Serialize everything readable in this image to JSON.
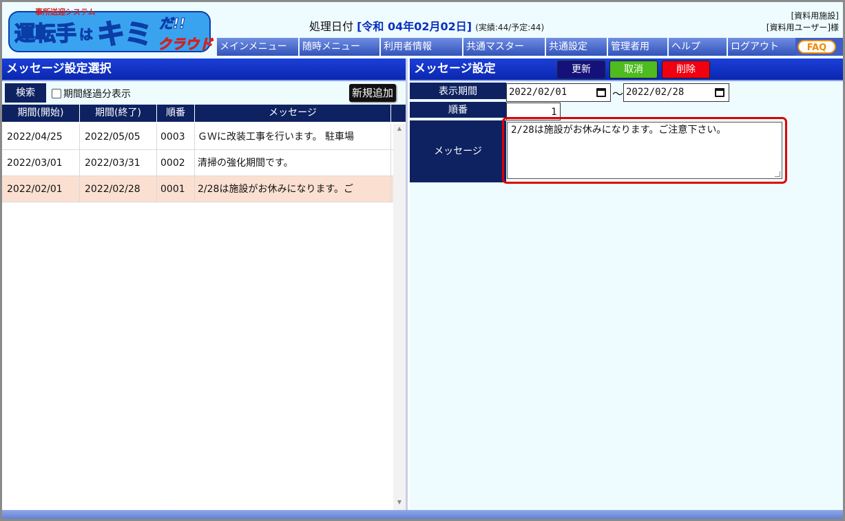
{
  "app": {
    "logo": {
      "tagline": "事所送迎システム",
      "name_a": "運転手",
      "name_b": "は",
      "name_c": "キミ",
      "name_d": "だ!!",
      "name_e": "クラウド"
    }
  },
  "header": {
    "proc_date_label": "処理日付",
    "proc_date_value": "[令和 04年02月02日]",
    "counts": "(実績:44/予定:44)",
    "facility": "[資料用施設]",
    "user": "[資料用ユーザー]様"
  },
  "menu": {
    "items": [
      {
        "label": "メインメニュー"
      },
      {
        "label": "随時メニュー"
      },
      {
        "label": "利用者情報"
      },
      {
        "label": "共通マスター"
      },
      {
        "label": "共通設定"
      },
      {
        "label": "管理者用"
      },
      {
        "label": "ヘルプ"
      },
      {
        "label": "ログアウト"
      }
    ],
    "faq": "FAQ"
  },
  "left_panel": {
    "title": "メッセージ設定選択",
    "search_label": "検索",
    "elapsed_checkbox_label": "期間経過分表示",
    "elapsed_checked": false,
    "add_button": "新規追加",
    "columns": [
      "期間(開始)",
      "期間(終了)",
      "順番",
      "メッセージ"
    ],
    "rows": [
      {
        "start": "2022/04/25",
        "end": "2022/05/05",
        "order": "0003",
        "message": "ＧＷに改装工事を行います。 駐車場",
        "selected": false
      },
      {
        "start": "2022/03/01",
        "end": "2022/03/31",
        "order": "0002",
        "message": "清掃の強化期間です。",
        "selected": false
      },
      {
        "start": "2022/02/01",
        "end": "2022/02/28",
        "order": "0001",
        "message": "2/28は施設がお休みになります。ご",
        "selected": true
      }
    ]
  },
  "right_panel": {
    "title": "メッセージ設定",
    "buttons": {
      "update": "更新",
      "cancel": "取消",
      "delete": "削除"
    },
    "labels": {
      "period": "表示期間",
      "order": "順番",
      "message": "メッセージ"
    },
    "period_start": "2022/02/01",
    "period_end": "2022/02/28",
    "tilde": "～",
    "order_value": "1",
    "message_value": "2/28は施設がお休みになります。ご注意下さい。"
  },
  "colors": {
    "accent": "#0c2cc4",
    "label_bg": "#0e2261",
    "selected_row": "#fbe0d2",
    "highlight": "#e00000"
  }
}
